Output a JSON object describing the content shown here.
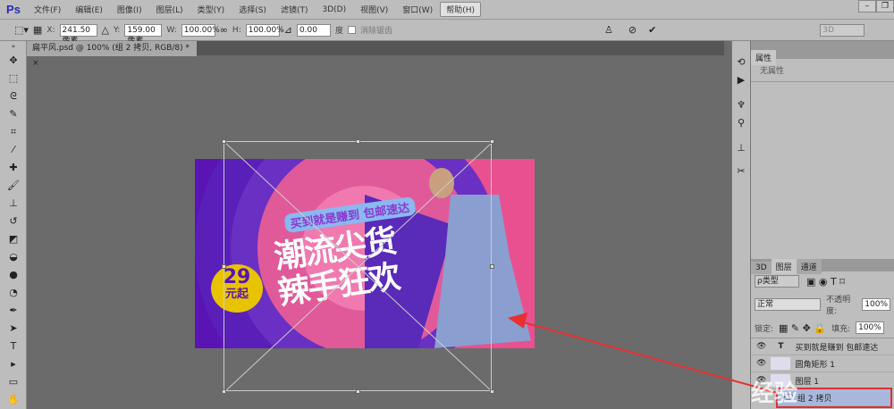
{
  "app": {
    "logo": "Ps"
  },
  "menu": [
    "文件(F)",
    "编辑(E)",
    "图像(I)",
    "图层(L)",
    "类型(Y)",
    "选择(S)",
    "滤镜(T)",
    "3D(D)",
    "视图(V)",
    "窗口(W)",
    "帮助(H)"
  ],
  "options": {
    "x_label": "X:",
    "x": "241.50 像素",
    "y_label": "Y:",
    "y": "159.00 像素",
    "w_label": "W:",
    "w": "100.00%",
    "h_label": "H:",
    "h": "100.00%",
    "angle": "0.00",
    "angle_unit": "度",
    "antialias": "消除锯齿",
    "workspace": "3D"
  },
  "document": {
    "tab": "扁平风.psd @ 100% (组 2 拷贝, RGB/8) *",
    "close": "×"
  },
  "banner": {
    "tagline": "买到就是赚到 包邮速达",
    "headline1": "潮流尖货",
    "headline2": "辣手狂欢",
    "price": "29",
    "price_suffix": "元起"
  },
  "properties": {
    "tab": "属性",
    "empty": "无属性"
  },
  "layers": {
    "tabs": [
      "3D",
      "图层",
      "通道"
    ],
    "filter": "ρ类型",
    "blend": "正常",
    "opacity_label": "不透明度:",
    "opacity": "100%",
    "lock_label": "锁定:",
    "fill_label": "填充:",
    "fill": "100%",
    "items": [
      {
        "type": "T",
        "name": "买到就是赚到 包邮速达"
      },
      {
        "type": "shape",
        "name": "圆角矩形 1"
      },
      {
        "type": "pixel",
        "name": "图层 1"
      },
      {
        "type": "group",
        "name": "组 2 拷贝"
      }
    ]
  },
  "watermark": "经验"
}
